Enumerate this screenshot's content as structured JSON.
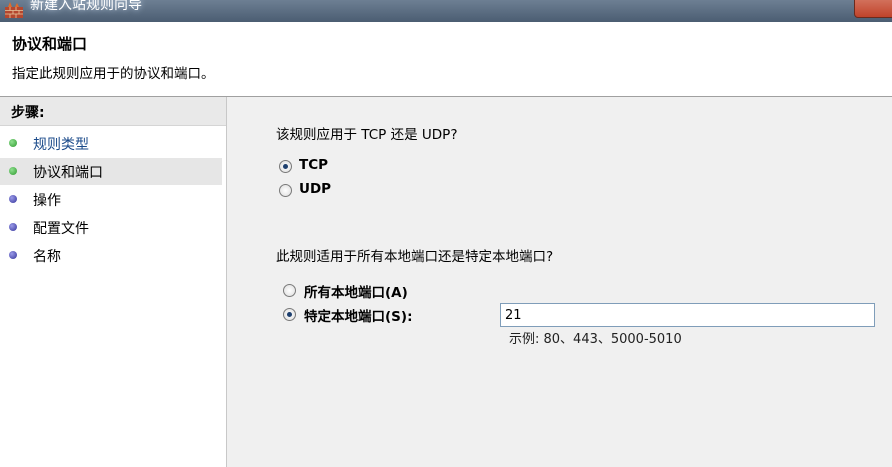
{
  "window": {
    "title": "新建入站规则向导"
  },
  "header": {
    "title": "协议和端口",
    "description": "指定此规则应用于的协议和端口。"
  },
  "sidebar": {
    "heading": "步骤:",
    "items": [
      {
        "label": "规则类型",
        "status": "done"
      },
      {
        "label": "协议和端口",
        "status": "active"
      },
      {
        "label": "操作",
        "status": "pending"
      },
      {
        "label": "配置文件",
        "status": "pending"
      },
      {
        "label": "名称",
        "status": "pending"
      }
    ]
  },
  "main": {
    "protocol_question": "该规则应用于 TCP 还是 UDP?",
    "protocol_options": [
      {
        "label": "TCP",
        "selected": true
      },
      {
        "label": "UDP",
        "selected": false
      }
    ],
    "port_question": "此规则适用于所有本地端口还是特定本地端口?",
    "port_options": [
      {
        "label": "所有本地端口(A)",
        "selected": false
      },
      {
        "label": "特定本地端口(S):",
        "selected": true
      }
    ],
    "port_value": "21",
    "port_example": "示例: 80、443、5000-5010"
  },
  "colors": {
    "done_dot": "#3ca83c",
    "pending_dot": "#4a4aa8",
    "active_bg": "#e6e6e6"
  },
  "icons": {
    "app": "firewall-wall-icon"
  }
}
